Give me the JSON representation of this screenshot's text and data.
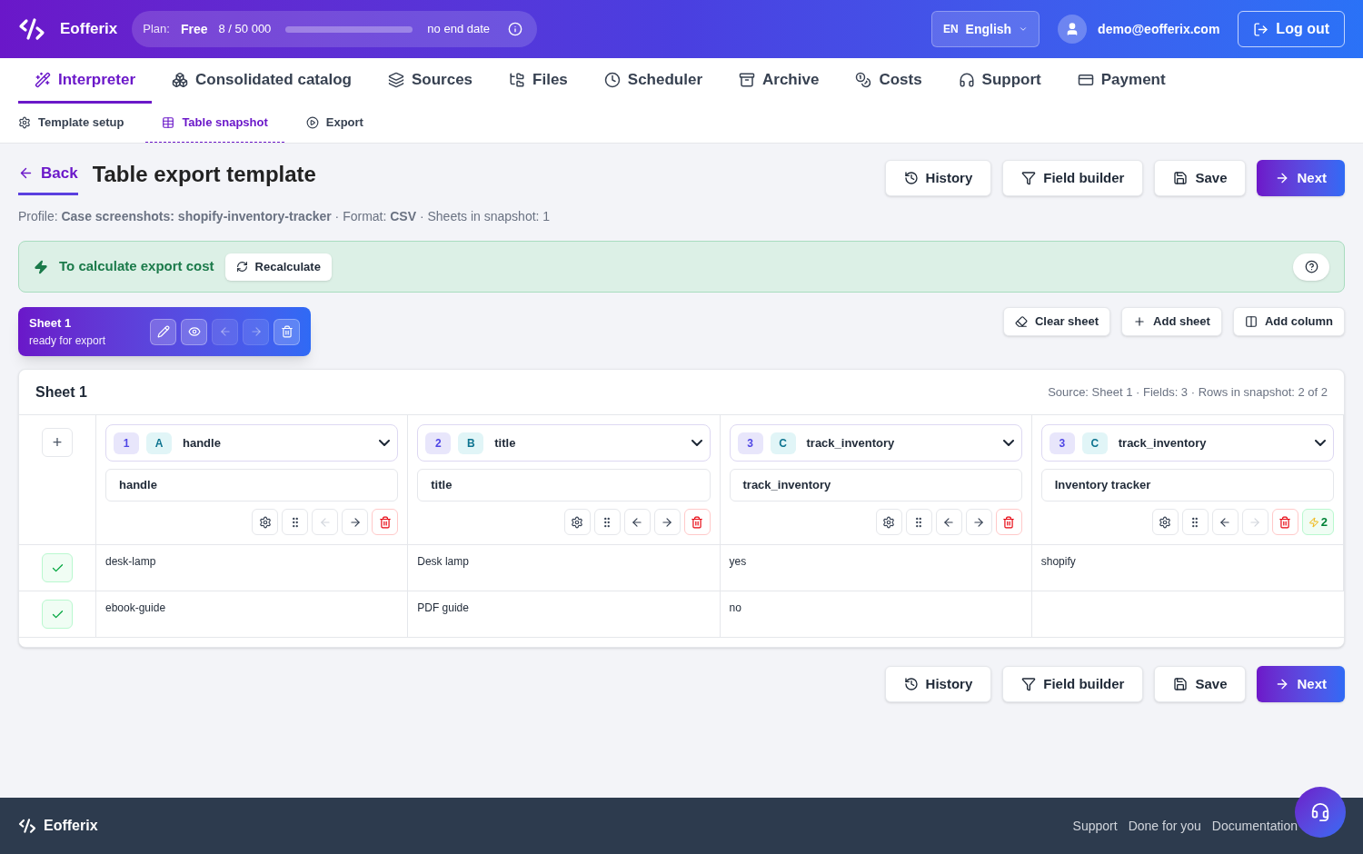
{
  "header": {
    "brand": "Eofferix",
    "plan": {
      "label": "Plan:",
      "name": "Free",
      "usage": "8 / 50 000",
      "level": 0.00016,
      "end": "no end date"
    },
    "language": {
      "code": "EN",
      "name": "English"
    },
    "user": "demo@eofferix.com",
    "logout": "Log out"
  },
  "nav": [
    {
      "label": "Interpreter",
      "selected": true
    },
    {
      "label": "Consolidated catalog",
      "selected": false
    },
    {
      "label": "Sources",
      "selected": false
    },
    {
      "label": "Files",
      "selected": false
    },
    {
      "label": "Scheduler",
      "selected": false
    },
    {
      "label": "Archive",
      "selected": false
    },
    {
      "label": "Costs",
      "selected": false
    },
    {
      "label": "Support",
      "selected": false
    },
    {
      "label": "Payment",
      "selected": false
    }
  ],
  "subtabs": [
    {
      "label": "Template setup",
      "selected": false
    },
    {
      "label": "Table snapshot",
      "selected": true
    },
    {
      "label": "Export",
      "selected": false
    }
  ],
  "back": "Back",
  "title": "Table export template",
  "actions": [
    {
      "label": "History",
      "kind": "plain"
    },
    {
      "label": "Field builder",
      "kind": "plain"
    },
    {
      "label": "Save",
      "kind": "plain"
    },
    {
      "label": "Next",
      "kind": "primary"
    }
  ],
  "profile": "Profile: **Case screenshots: shopify-inventory-tracker** · Format: **CSV** · Sheets in snapshot: 1",
  "cost_banner": {
    "text": "To calculate export cost",
    "button": "Recalculate"
  },
  "sheet_card": {
    "name": "Sheet 1",
    "status": "ready for export",
    "tools": [
      {
        "disabled": false
      },
      {
        "disabled": false
      },
      {
        "disabled": true
      },
      {
        "disabled": true
      },
      {
        "disabled": false
      }
    ]
  },
  "sheet_actions": [
    {
      "label": "Clear sheet"
    },
    {
      "label": "Add sheet"
    },
    {
      "label": "Add column"
    }
  ],
  "sheet": {
    "title": "Sheet 1",
    "info": "Source: Sheet 1 · Fields: 3 · Rows in snapshot: 2 of 2",
    "add_column": "+",
    "columns": [
      {
        "index": "1",
        "letter": "A",
        "field": "handle",
        "header": "handle",
        "left_disabled": true,
        "right_disabled": false
      },
      {
        "index": "2",
        "letter": "B",
        "field": "title",
        "header": "title",
        "left_disabled": false,
        "right_disabled": false
      },
      {
        "index": "3",
        "letter": "C",
        "field": "track_inventory",
        "header": "track_inventory",
        "left_disabled": false,
        "right_disabled": false
      },
      {
        "index": "3",
        "letter": "C",
        "field": "track_inventory",
        "header": "Inventory tracker",
        "left_disabled": false,
        "right_disabled": true,
        "badge": "2"
      }
    ],
    "rows": [
      {
        "checked": true,
        "cells": [
          "desk-lamp",
          "Desk lamp",
          "yes",
          "shopify"
        ]
      },
      {
        "checked": true,
        "cells": [
          "ebook-guide",
          "PDF guide",
          "no",
          ""
        ]
      }
    ]
  },
  "bottom_actions": [
    {
      "label": "History",
      "kind": "plain"
    },
    {
      "label": "Field builder",
      "kind": "plain"
    },
    {
      "label": "Save",
      "kind": "plain"
    },
    {
      "label": "Next",
      "kind": "primary"
    }
  ],
  "footer": {
    "brand": "Eofferix",
    "links": [
      "Support",
      "Done for you",
      "Documentation"
    ]
  }
}
